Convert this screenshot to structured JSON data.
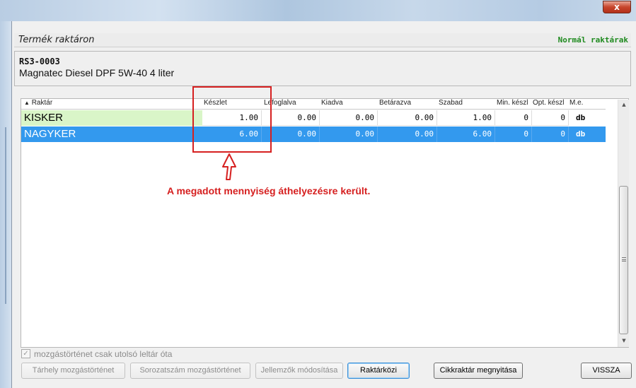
{
  "window": {
    "close_label": "x"
  },
  "header": {
    "title": "Termék raktáron",
    "right_label": "Normál raktárak"
  },
  "product": {
    "code": "RS3-0003",
    "name": "Magnatec Diesel DPF 5W-40 4 liter"
  },
  "grid": {
    "sort_icon": "▲",
    "columns": [
      "Raktár",
      "Készlet",
      "Lefoglalva",
      "Kiadva",
      "Betárazva",
      "Szabad",
      "Min. készl",
      "Opt. készl",
      "M.e."
    ],
    "rows": [
      {
        "name": "KISKER",
        "keszlet": "1.00",
        "lefoglalva": "0.00",
        "kiadva": "0.00",
        "betarazva": "0.00",
        "szabad": "1.00",
        "min": "0",
        "opt": "0",
        "me": "db"
      },
      {
        "name": "NAGYKER",
        "keszlet": "6.00",
        "lefoglalva": "0.00",
        "kiadva": "0.00",
        "betarazva": "0.00",
        "szabad": "6.00",
        "min": "0",
        "opt": "0",
        "me": "db"
      }
    ]
  },
  "scrollbar": {
    "up": "▲",
    "down": "▼"
  },
  "annotation": {
    "text": "A megadott mennyiség áthelyezésre került."
  },
  "checkbox": {
    "label": "mozgástörténet csak utolsó leltár óta",
    "mark": "✓"
  },
  "buttons": {
    "tarhely": "Tárhely mozgástörténet",
    "sorozatszam": "Sorozatszám mozgástörténet",
    "jellemzok": "Jellemzők módosítása",
    "raktarkozi": "Raktárközi",
    "cikkraktar": "Cikkraktár megnyitása",
    "vissza": "VISSZA"
  },
  "colors": {
    "selection": "#3399ee",
    "kisker_bg": "#d9f5c8",
    "annotation": "#d62020",
    "normal_raktarak": "#1e8a1e"
  }
}
